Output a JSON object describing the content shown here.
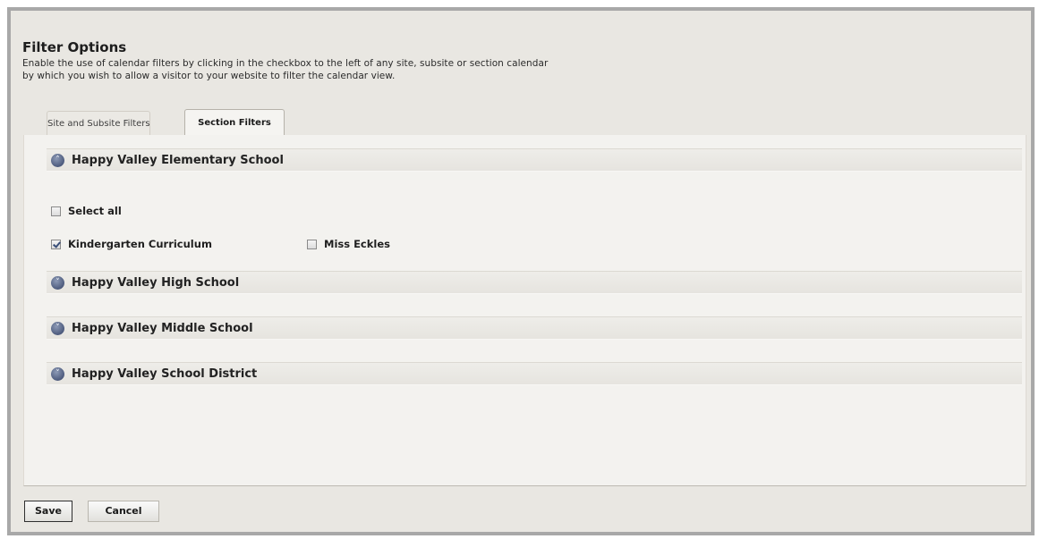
{
  "header": {
    "title": "Filter Options",
    "description_line1": "Enable the use of calendar filters by clicking in the checkbox to the left of any site, subsite or section calendar",
    "description_line2": "by which you wish to allow a visitor to your website to filter the calendar view."
  },
  "tabs": [
    {
      "label": "Site and Subsite Filters",
      "active": false
    },
    {
      "label": "Section Filters",
      "active": true
    }
  ],
  "sections": [
    {
      "title": "Happy Valley Elementary School",
      "expanded": true,
      "icon": "collapse-icon"
    },
    {
      "title": "Happy Valley High School",
      "expanded": false,
      "icon": "expand-icon"
    },
    {
      "title": "Happy Valley Middle School",
      "expanded": false,
      "icon": "expand-icon"
    },
    {
      "title": "Happy Valley School District",
      "expanded": false,
      "icon": "expand-icon"
    }
  ],
  "elementary_filters": {
    "select_all": {
      "label": "Select all",
      "checked": false
    },
    "items": [
      {
        "label": "Kindergarten Curriculum",
        "checked": true
      },
      {
        "label": "Miss Eckles",
        "checked": false
      }
    ]
  },
  "footer": {
    "save_label": "Save",
    "cancel_label": "Cancel"
  },
  "colors": {
    "background": "#e9e7e2",
    "panel": "#f3f2ef",
    "icon": "#5a6788",
    "border": "#a8a8a8"
  }
}
